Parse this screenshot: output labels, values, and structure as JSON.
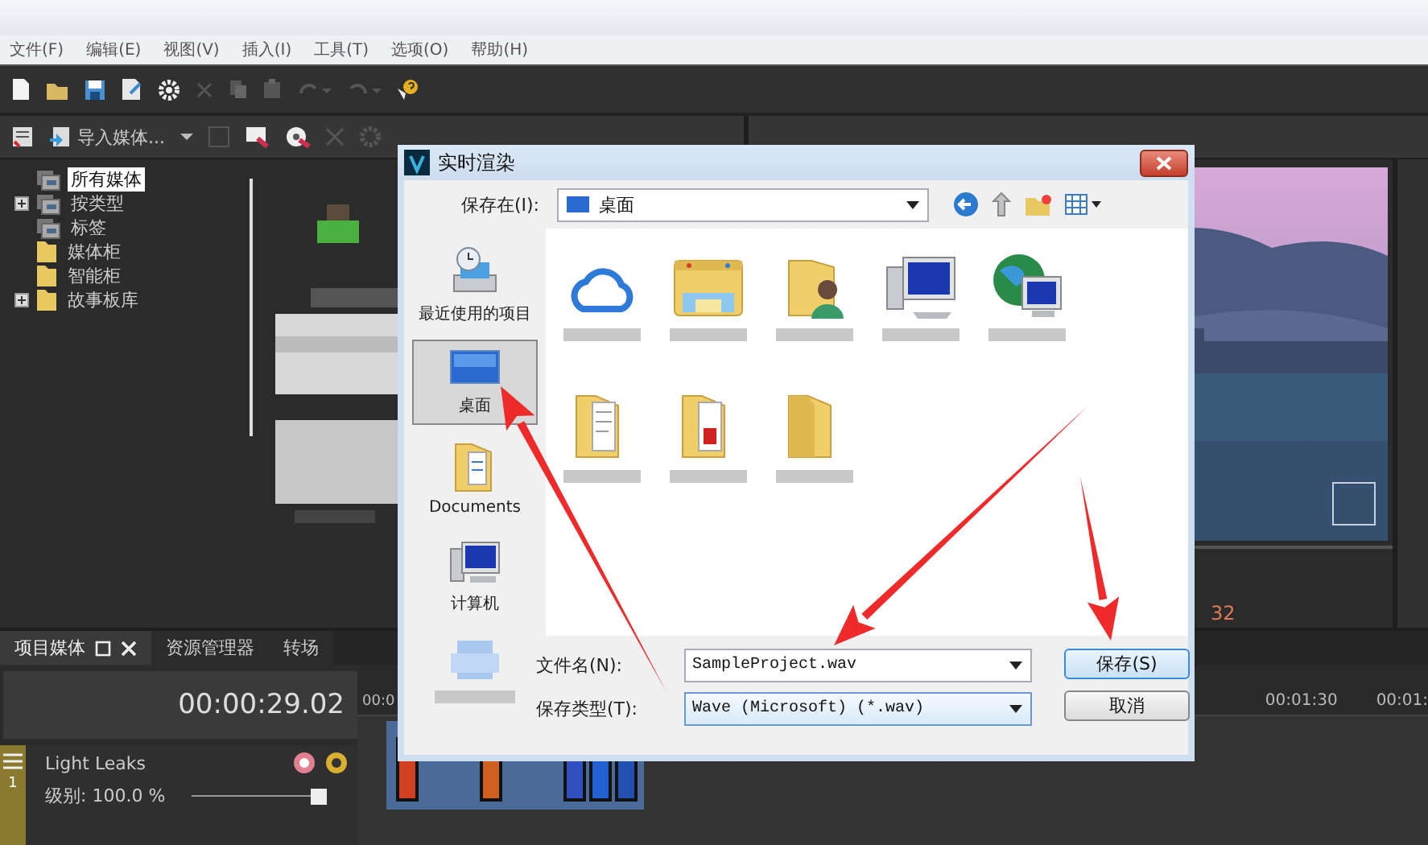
{
  "app": {
    "menu": [
      "文件(F)",
      "编辑(E)",
      "视图(V)",
      "插入(I)",
      "工具(T)",
      "选项(O)",
      "帮助(H)"
    ],
    "import_label": "导入媒体...",
    "media_tree": [
      {
        "label": "所有媒体",
        "kind": "group",
        "expandable": false,
        "selected": true
      },
      {
        "label": "按类型",
        "kind": "group",
        "expandable": true,
        "selected": false
      },
      {
        "label": "标签",
        "kind": "group",
        "expandable": false,
        "selected": false
      },
      {
        "label": "媒体柜",
        "kind": "folder",
        "expandable": false,
        "selected": false
      },
      {
        "label": "智能柜",
        "kind": "folder",
        "expandable": false,
        "selected": false
      },
      {
        "label": "故事板库",
        "kind": "folder",
        "expandable": true,
        "selected": false
      }
    ],
    "panel_tabs": [
      {
        "label": "项目媒体",
        "selected": true
      },
      {
        "label": "资源管理器",
        "selected": false
      },
      {
        "label": "转场",
        "selected": false
      }
    ],
    "preview_frame": "32",
    "timecode": "00:00:29.02",
    "track": {
      "number": "1",
      "name": "Light Leaks",
      "level_label": "级别: 100.0 %",
      "level": 1.0
    },
    "ruler": [
      "00:0",
      "00:01:30",
      "00:01:"
    ]
  },
  "dialog": {
    "title": "实时渲染",
    "save_in_label": "保存在(I):",
    "save_in": "桌面",
    "places": [
      {
        "label": "最近使用的项目",
        "kind": "recent",
        "selected": false
      },
      {
        "label": "桌面",
        "kind": "desktop",
        "selected": true
      },
      {
        "label": "Documents",
        "kind": "documents",
        "selected": false
      },
      {
        "label": "计算机",
        "kind": "computer",
        "selected": false
      },
      {
        "kind": "network",
        "selected": false
      }
    ],
    "files": [
      {
        "kind": "cloud"
      },
      {
        "kind": "library"
      },
      {
        "kind": "user-folder"
      },
      {
        "kind": "computer"
      },
      {
        "kind": "network"
      },
      {
        "kind": "doc-folder"
      },
      {
        "kind": "red-folder"
      },
      {
        "kind": "folder"
      }
    ],
    "filename_label": "文件名(N):",
    "filename": "SampleProject.wav",
    "filetype_label": "保存类型(T):",
    "filetype": "Wave (Microsoft) (*.wav)",
    "buttons": [
      {
        "label": "保存(S)",
        "default": true
      },
      {
        "label": "取消",
        "default": false
      }
    ]
  }
}
